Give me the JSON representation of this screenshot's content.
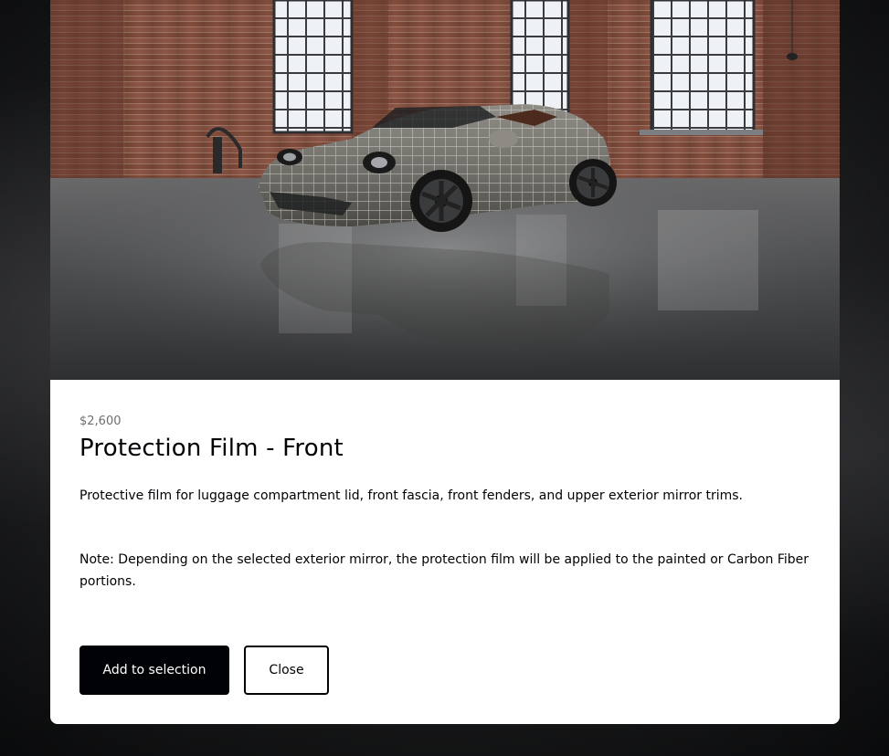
{
  "product": {
    "price": "$2,600",
    "title": "Protection Film - Front",
    "description": "Protective film for luggage compartment lid, front fascia, front fenders, and upper exterior mirror trims.",
    "note": "Note: Depending on the selected exterior mirror, the protection film will be applied to the painted or Carbon Fiber portions."
  },
  "actions": {
    "add_label": "Add to selection",
    "close_label": "Close"
  },
  "colors": {
    "primary_button_bg": "#010205",
    "text": "#010205",
    "muted_text": "#6b6d70",
    "modal_bg": "#ffffff"
  },
  "hero_image": {
    "subject": "convertible-sports-car-with-protection-film-grid-in-brick-warehouse"
  }
}
